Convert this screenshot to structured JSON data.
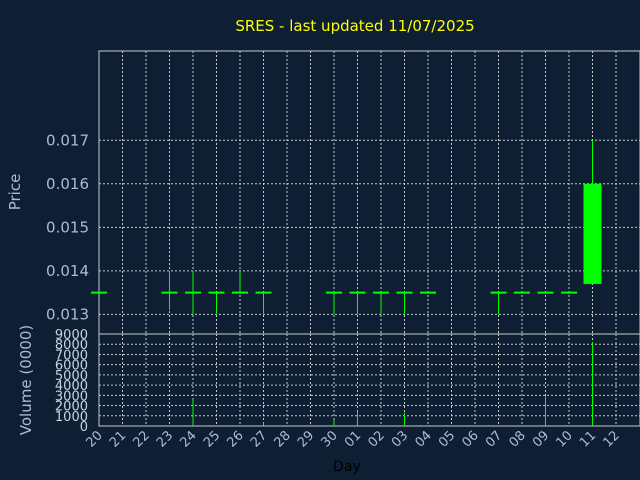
{
  "chart_data": {
    "type": "candlestick",
    "title": "SRES - last updated 11/07/2025",
    "xlabel": "Day",
    "price_panel": {
      "ylabel": "Price",
      "yticks": [
        "0.013",
        "0.014",
        "0.015",
        "0.016",
        "0.017"
      ],
      "ylim": [
        0.01255,
        0.01905
      ],
      "grid": true
    },
    "volume_panel": {
      "ylabel": "Volume (0000)",
      "yticks": [
        "0",
        "1000",
        "2000",
        "3000",
        "4000",
        "5000",
        "6000",
        "7000",
        "8000",
        "9000"
      ],
      "ylim": [
        0,
        9000
      ],
      "grid": true
    },
    "x_labels": [
      "20",
      "21",
      "22",
      "23",
      "24",
      "25",
      "26",
      "27",
      "28",
      "29",
      "30",
      "01",
      "02",
      "03",
      "04",
      "05",
      "06",
      "07",
      "08",
      "09",
      "10",
      "11",
      "12"
    ],
    "candles": [
      {
        "day": "20",
        "open": 0.0135,
        "high": 0.0135,
        "low": 0.0135,
        "close": 0.0135,
        "volume": 0
      },
      {
        "day": "23",
        "open": 0.0135,
        "high": 0.014,
        "low": 0.0131,
        "close": 0.0135,
        "volume": 0
      },
      {
        "day": "24",
        "open": 0.0135,
        "high": 0.014,
        "low": 0.013,
        "close": 0.0135,
        "volume": 2600
      },
      {
        "day": "25",
        "open": 0.0135,
        "high": 0.0135,
        "low": 0.013,
        "close": 0.0135,
        "volume": 0
      },
      {
        "day": "26",
        "open": 0.0135,
        "high": 0.014,
        "low": 0.0135,
        "close": 0.0135,
        "volume": 0
      },
      {
        "day": "27",
        "open": 0.0135,
        "high": 0.0135,
        "low": 0.013,
        "close": 0.0135,
        "volume": 300
      },
      {
        "day": "30",
        "open": 0.0135,
        "high": 0.0135,
        "low": 0.013,
        "close": 0.0135,
        "volume": 600
      },
      {
        "day": "01",
        "open": 0.0135,
        "high": 0.0135,
        "low": 0.013,
        "close": 0.0135,
        "volume": 1400
      },
      {
        "day": "02",
        "open": 0.0135,
        "high": 0.0135,
        "low": 0.013,
        "close": 0.0135,
        "volume": 0
      },
      {
        "day": "03",
        "open": 0.0135,
        "high": 0.0135,
        "low": 0.013,
        "close": 0.0135,
        "volume": 1300
      },
      {
        "day": "04",
        "open": 0.0135,
        "high": 0.0135,
        "low": 0.0135,
        "close": 0.0135,
        "volume": 0
      },
      {
        "day": "07",
        "open": 0.0135,
        "high": 0.0135,
        "low": 0.013,
        "close": 0.0135,
        "volume": 0
      },
      {
        "day": "08",
        "open": 0.0135,
        "high": 0.0135,
        "low": 0.0135,
        "close": 0.0135,
        "volume": 0
      },
      {
        "day": "09",
        "open": 0.0135,
        "high": 0.0135,
        "low": 0.0135,
        "close": 0.0135,
        "volume": 2900
      },
      {
        "day": "10",
        "open": 0.0135,
        "high": 0.0135,
        "low": 0.0135,
        "close": 0.0135,
        "volume": 0
      },
      {
        "day": "11",
        "open": 0.0137,
        "high": 0.017,
        "low": 0.0137,
        "close": 0.016,
        "volume": 8200
      }
    ],
    "colors": {
      "background": "#0f1f33",
      "title": "#ffff00",
      "axis_text": "#a8bdd6",
      "grid": "#c8c8c8",
      "candle": "#00ff00"
    }
  }
}
